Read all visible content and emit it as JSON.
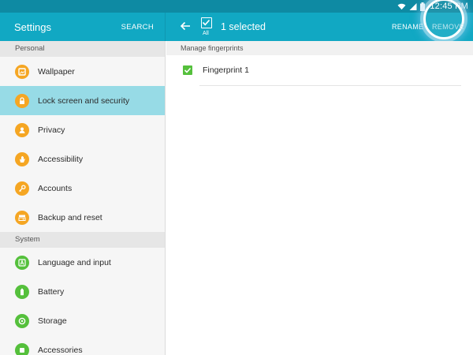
{
  "status_bar": {
    "time": "12:45 PM",
    "icons": [
      "wifi-icon",
      "signal-icon",
      "battery-icon"
    ]
  },
  "settings_header": {
    "title": "Settings",
    "search_label": "SEARCH"
  },
  "selection_header": {
    "all_label": "All",
    "selected_text": "1 selected",
    "rename_label": "RENAME",
    "remove_label": "REMOVE"
  },
  "sidebar": {
    "sections": [
      {
        "label": "Personal",
        "items": [
          {
            "label": "Wallpaper",
            "icon": "wallpaper-icon"
          },
          {
            "label": "Lock screen and security",
            "icon": "lock-icon",
            "active": true
          },
          {
            "label": "Privacy",
            "icon": "privacy-icon"
          },
          {
            "label": "Accessibility",
            "icon": "hand-icon"
          },
          {
            "label": "Accounts",
            "icon": "key-icon"
          },
          {
            "label": "Backup and reset",
            "icon": "backup-icon"
          }
        ]
      },
      {
        "label": "System",
        "items": [
          {
            "label": "Language and input",
            "icon": "language-icon"
          },
          {
            "label": "Battery",
            "icon": "battery-icon"
          },
          {
            "label": "Storage",
            "icon": "storage-icon"
          },
          {
            "label": "Accessories",
            "icon": "accessories-icon"
          }
        ]
      }
    ]
  },
  "content": {
    "section_label": "Manage fingerprints",
    "fingerprints": [
      {
        "label": "Fingerprint 1",
        "checked": true
      }
    ]
  },
  "colors": {
    "status_bar": "#0e8aa3",
    "app_bar": "#11a8c3",
    "active_item": "#97dbe6",
    "orange_icon": "#f5a623",
    "green_icon": "#55c03c"
  }
}
